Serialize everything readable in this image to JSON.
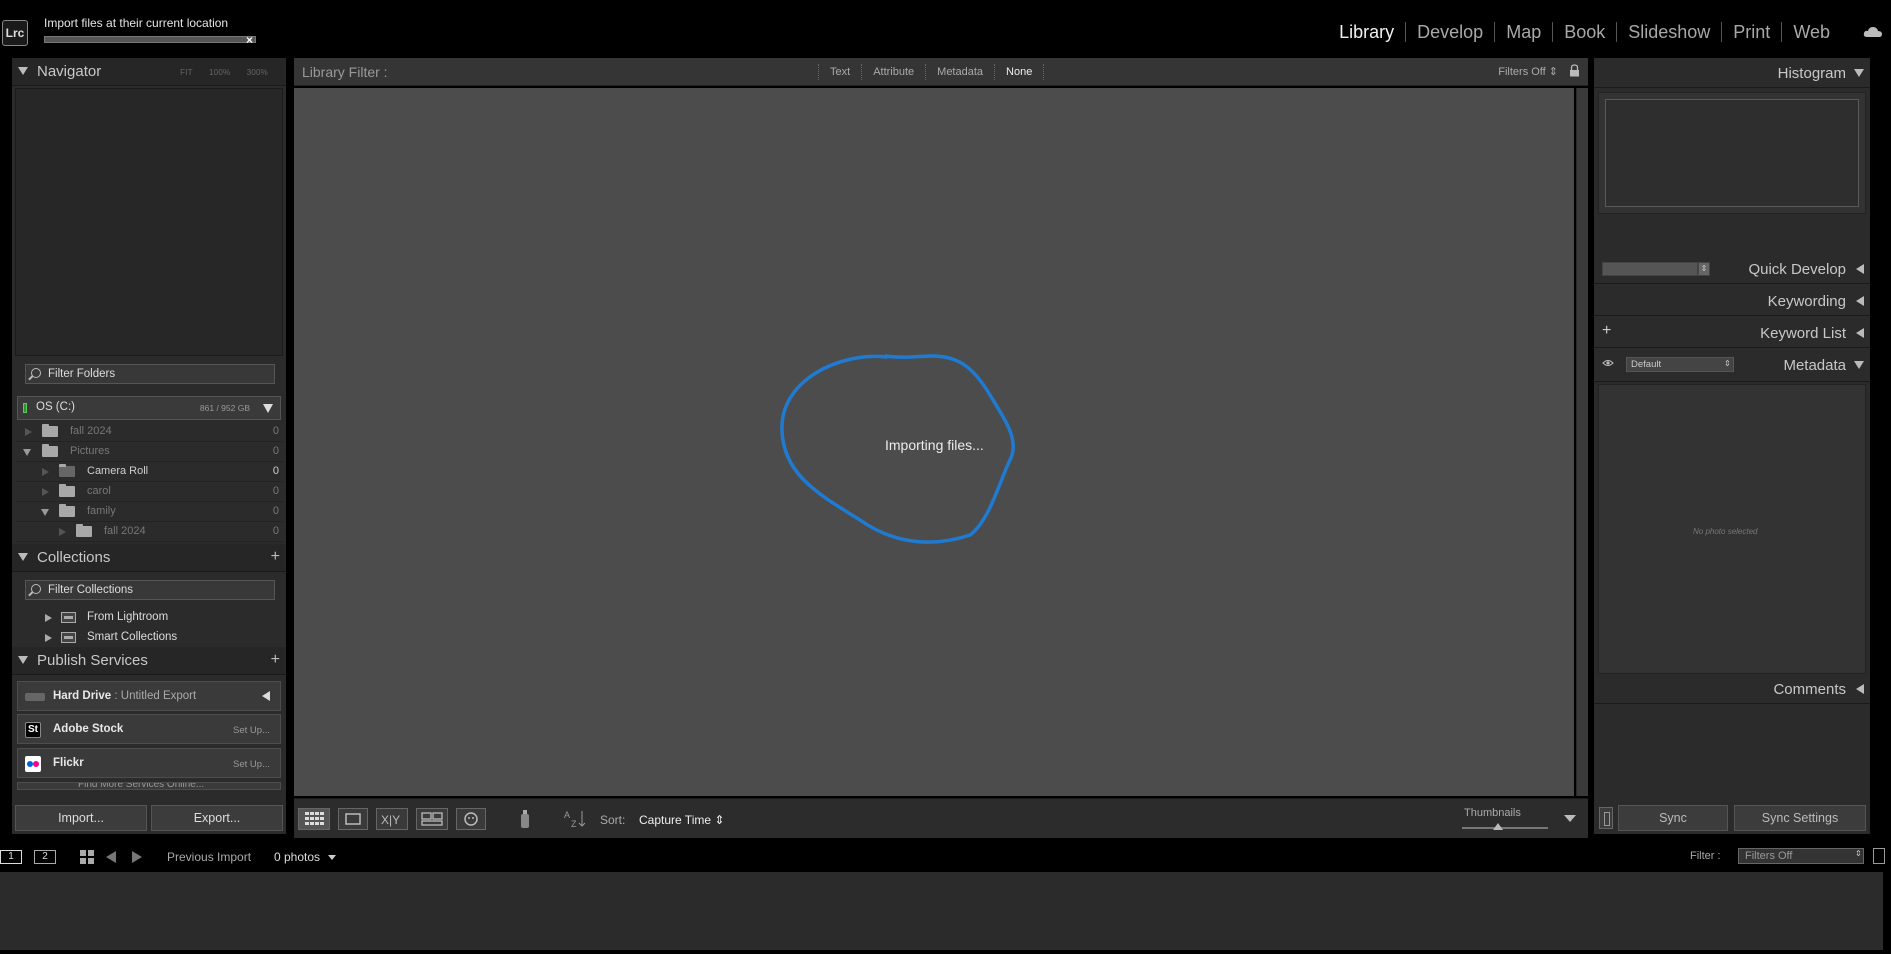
{
  "top": {
    "logo": "Lrc",
    "import_message": "Import files at their current location",
    "import_progress": 0,
    "cancel": "×",
    "modules": [
      "Library",
      "Develop",
      "Map",
      "Book",
      "Slideshow",
      "Print",
      "Web"
    ],
    "active_module": "Library",
    "cloud_icon": "cloud-sync-icon"
  },
  "left": {
    "navigator": {
      "title": "Navigator",
      "zoom": [
        "FIT",
        "100%",
        "300%"
      ]
    },
    "folders": {
      "filter_placeholder": "Filter Folders",
      "volume": {
        "name": "OS (C:)",
        "size": "861 / 952 GB"
      },
      "items": [
        {
          "name": "fall 2024",
          "count": "0"
        },
        {
          "name": "Pictures",
          "count": "0"
        },
        {
          "name": "Camera Roll",
          "count": "0"
        },
        {
          "name": "carol",
          "count": "0"
        },
        {
          "name": "family",
          "count": "0"
        },
        {
          "name": "fall 2024",
          "count": "0"
        }
      ]
    },
    "collections": {
      "title": "Collections",
      "filter_placeholder": "Filter Collections",
      "items": [
        "From Lightroom",
        "Smart Collections"
      ]
    },
    "publish": {
      "title": "Publish Services",
      "services": [
        {
          "name": "Hard Drive",
          "sub": ": Untitled Export"
        },
        {
          "name": "Adobe Stock",
          "action": "Set Up..."
        },
        {
          "name": "Flickr",
          "action": "Set Up..."
        }
      ],
      "find_more": "Find More Services Online..."
    },
    "import_button": "Import...",
    "export_button": "Export..."
  },
  "center": {
    "filter_title": "Library Filter :",
    "filter_tabs": [
      "Text",
      "Attribute",
      "Metadata",
      "None"
    ],
    "filters_off": "Filters Off ⇕",
    "status": "Importing files...",
    "sort_label": "Sort:",
    "sort_value": "Capture Time ⇕",
    "thumbnails_label": "Thumbnails",
    "thumbnail_size": 0.4
  },
  "right": {
    "histogram": "Histogram",
    "quick_develop": "Quick Develop",
    "keywording": "Keywording",
    "keyword_list": "Keyword List",
    "keyword_add": "+",
    "metadata": "Metadata",
    "metadata_preset": "Default",
    "no_photo": "No photo selected",
    "comments": "Comments",
    "sync": "Sync",
    "sync_settings": "Sync Settings"
  },
  "filmstrip": {
    "screen1": "1",
    "screen2": "2",
    "source": "Previous Import",
    "count": "0 photos",
    "filter_label": "Filter :",
    "filter_value": "Filters Off"
  },
  "colors": {
    "annotation": "#1f7bd1",
    "panel_bg": "#2b2b2b",
    "grid_bg": "#4c4c4c"
  }
}
